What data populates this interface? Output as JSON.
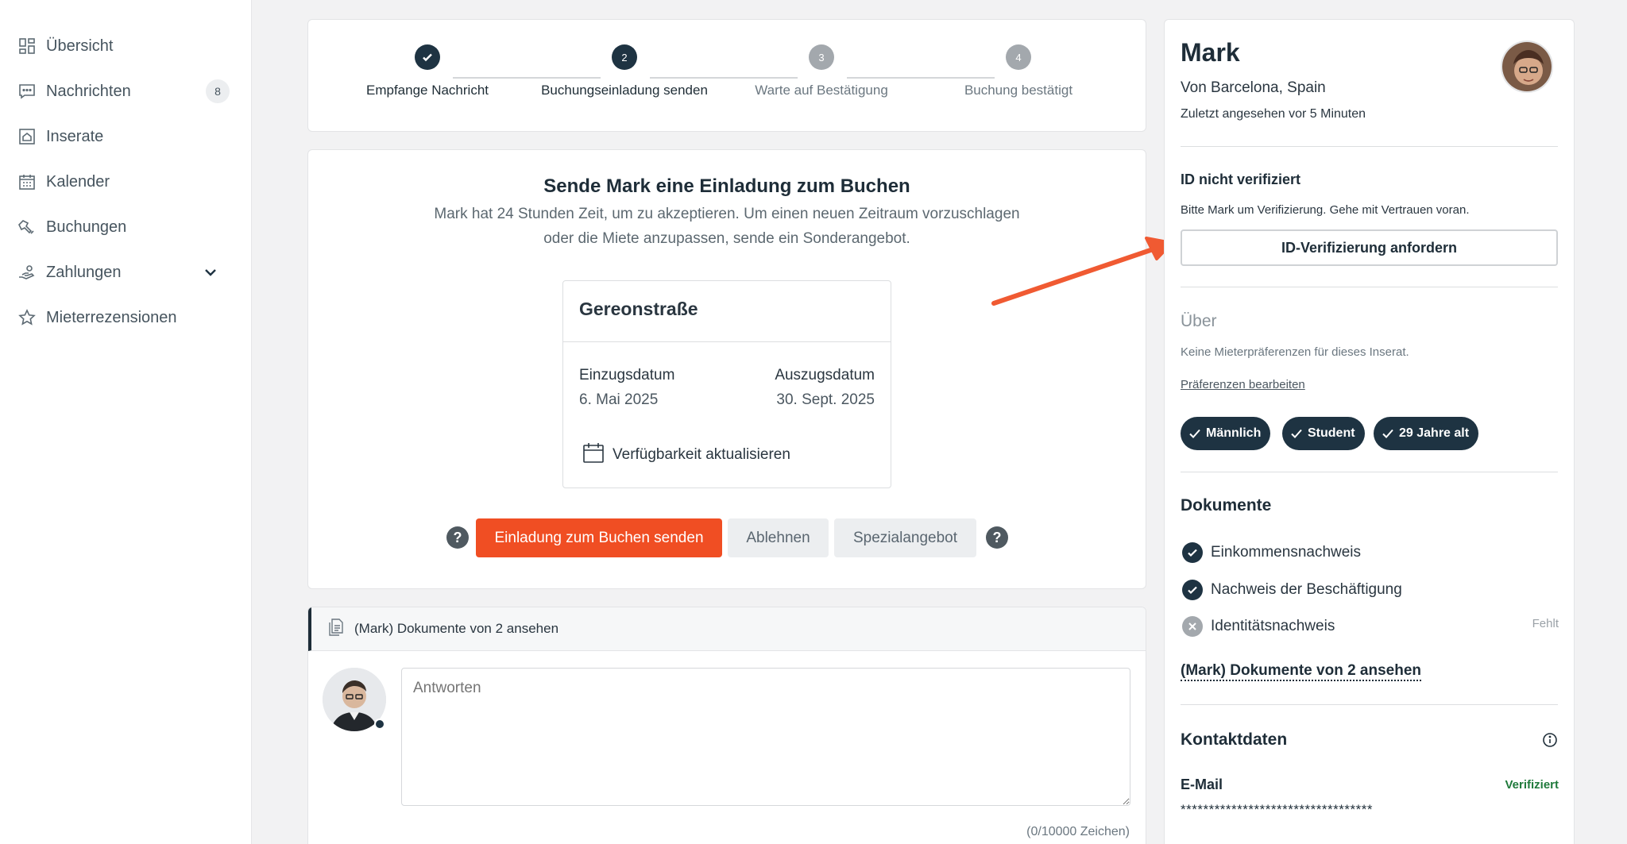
{
  "sidebar": {
    "items": [
      {
        "label": "Übersicht",
        "icon": "dashboard-icon"
      },
      {
        "label": "Nachrichten",
        "icon": "message-icon",
        "badge": "8"
      },
      {
        "label": "Inserate",
        "icon": "listing-icon"
      },
      {
        "label": "Kalender",
        "icon": "calendar-icon"
      },
      {
        "label": "Buchungen",
        "icon": "bookings-icon"
      },
      {
        "label": "Zahlungen",
        "icon": "payments-icon"
      },
      {
        "label": "Mieterrezensionen",
        "icon": "star-icon"
      }
    ]
  },
  "stepper": {
    "steps": [
      {
        "label": "Empfange Nachricht",
        "marker": "",
        "state": "done"
      },
      {
        "label": "Buchungseinladung senden",
        "marker": "2",
        "state": "active"
      },
      {
        "label": "Warte auf Bestätigung",
        "marker": "3",
        "state": "pending"
      },
      {
        "label": "Buchung bestätigt",
        "marker": "4",
        "state": "pending"
      }
    ]
  },
  "invite": {
    "title": "Sende Mark eine Einladung zum Buchen",
    "desc_line1": "Mark hat 24 Stunden Zeit, um zu akzeptieren. Um einen neuen Zeitraum vorzuschlagen",
    "desc_line2": "oder die Miete anzupassen, sende ein Sonderangebot.",
    "property": "Gereonstraße",
    "movein_label": "Einzugsdatum",
    "movein_value": "6. Mai 2025",
    "moveout_label": "Auszugsdatum",
    "moveout_value": "30. Sept. 2025",
    "availability_label": "Verfügbarkeit aktualisieren",
    "send_button": "Einladung zum Buchen senden",
    "decline_button": "Ablehnen",
    "special_button": "Spezialangebot",
    "help_glyph": "?"
  },
  "messages": {
    "docs_link": "(Mark) Dokumente von 2 ansehen",
    "reply_placeholder": "Antworten",
    "char_count": "(0/10000 Zeichen)"
  },
  "profile": {
    "name": "Mark",
    "origin": "Von Barcelona, Spain",
    "last_seen": "Zuletzt angesehen vor 5 Minuten",
    "id_title": "ID nicht verifiziert",
    "id_text": "Bitte Mark um Verifizierung. Gehe mit Vertrauen voran.",
    "id_button": "ID-Verifizierung anfordern",
    "about_title": "Über",
    "about_text": "Keine Mieterpräferenzen für dieses Inserat.",
    "edit_prefs": "Präferenzen bearbeiten",
    "tags": [
      "Männlich",
      "Student",
      "29 Jahre alt"
    ],
    "docs_title": "Dokumente",
    "documents": [
      {
        "label": "Einkommensnachweis",
        "status": "ok"
      },
      {
        "label": "Nachweis der Beschäftigung",
        "status": "ok"
      },
      {
        "label": "Identitätsnachweis",
        "status": "missing"
      }
    ],
    "missing_label": "Fehlt",
    "docs_link": "(Mark) Dokumente von 2 ansehen",
    "contact_title": "Kontaktdaten",
    "email_label": "E-Mail",
    "email_status": "Verifiziert",
    "email_value": "**********************************"
  },
  "colors": {
    "primary": "#f04e23",
    "dark": "#1e3342",
    "success": "#1f7a3b",
    "arrow": "#f05a32"
  }
}
